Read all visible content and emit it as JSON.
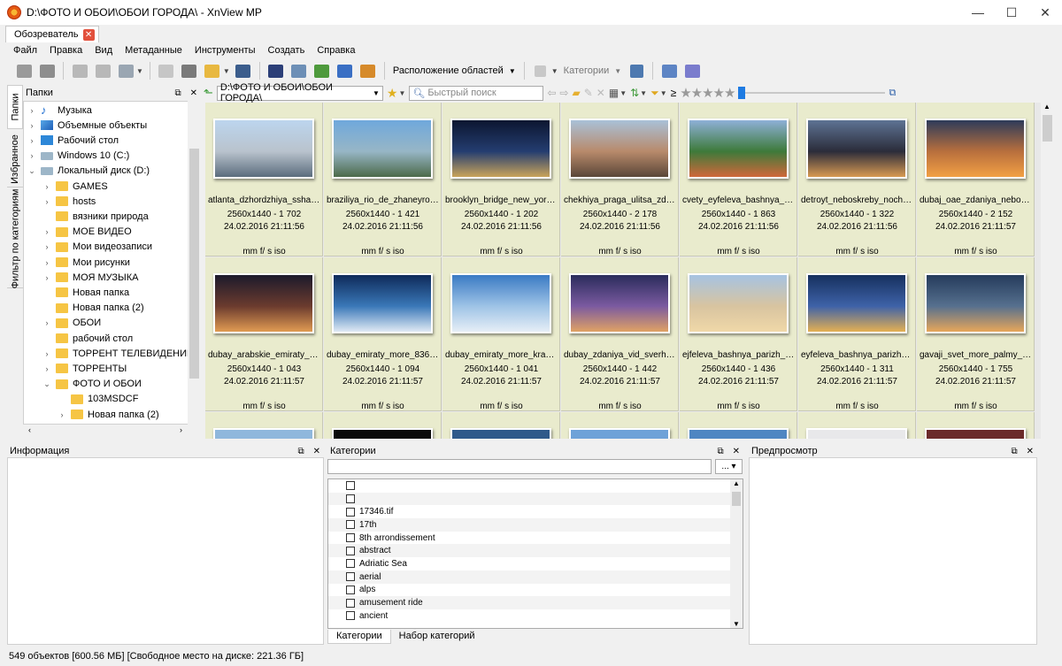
{
  "window": {
    "title": "D:\\ФОТО И ОБОИ\\ОБОИ ГОРОДА\\ - XnView MP",
    "min": "—",
    "max": "☐",
    "close": "✕"
  },
  "tab": {
    "label": "Обозреватель",
    "close": "✕"
  },
  "menu": [
    "Файл",
    "Правка",
    "Вид",
    "Метаданные",
    "Инструменты",
    "Создать",
    "Справка"
  ],
  "toolbar": {
    "layout_label": "Расположение областей",
    "categories_label": "Категории",
    "icons": [
      "back-view-icon",
      "fullscreen-icon",
      "rotate-left-icon",
      "rotate-right-icon",
      "image-menu-icon",
      "compare-icon",
      "print-icon",
      "open-icon",
      "find-icon",
      "folder-view-icon",
      "convert-icon",
      "slideshow-icon",
      "capture-icon",
      "wallpaper-icon",
      "settings-icon",
      "help-icon"
    ]
  },
  "folders_panel": {
    "title": "Папки",
    "vertical_tabs": [
      "Папки",
      "Избранное",
      "Фильтр по категориям"
    ],
    "tree": [
      {
        "label": "Музыка",
        "indent": 1,
        "expander": "›",
        "icon": "music"
      },
      {
        "label": "Объемные объекты",
        "indent": 1,
        "expander": "›",
        "icon": "3d"
      },
      {
        "label": "Рабочий стол",
        "indent": 1,
        "expander": "›",
        "icon": "desktop"
      },
      {
        "label": "Windows 10 (C:)",
        "indent": 1,
        "expander": "›",
        "icon": "drive"
      },
      {
        "label": "Локальный диск (D:)",
        "indent": 1,
        "expander": "⌄",
        "icon": "drive"
      },
      {
        "label": "GAMES",
        "indent": 2,
        "expander": "›",
        "icon": "folder"
      },
      {
        "label": "hosts",
        "indent": 2,
        "expander": "›",
        "icon": "folder"
      },
      {
        "label": "вязники природа",
        "indent": 2,
        "expander": "",
        "icon": "folder"
      },
      {
        "label": "МОЕ ВИДЕО",
        "indent": 2,
        "expander": "›",
        "icon": "folder"
      },
      {
        "label": "Мои видеозаписи",
        "indent": 2,
        "expander": "›",
        "icon": "folder"
      },
      {
        "label": "Мои рисунки",
        "indent": 2,
        "expander": "›",
        "icon": "folder"
      },
      {
        "label": "МОЯ МУЗЫКА",
        "indent": 2,
        "expander": "›",
        "icon": "folder"
      },
      {
        "label": "Новая папка",
        "indent": 2,
        "expander": "",
        "icon": "folder"
      },
      {
        "label": "Новая папка (2)",
        "indent": 2,
        "expander": "",
        "icon": "folder"
      },
      {
        "label": "ОБОИ",
        "indent": 2,
        "expander": "›",
        "icon": "folder"
      },
      {
        "label": "рабочий стол",
        "indent": 2,
        "expander": "",
        "icon": "folder"
      },
      {
        "label": "ТОРРЕНТ ТЕЛЕВИДЕНИЕ",
        "indent": 2,
        "expander": "›",
        "icon": "folder"
      },
      {
        "label": "ТОРРЕНТЫ",
        "indent": 2,
        "expander": "›",
        "icon": "folder"
      },
      {
        "label": "ФОТО И ОБОИ",
        "indent": 2,
        "expander": "⌄",
        "icon": "folder"
      },
      {
        "label": "103MSDCF",
        "indent": 3,
        "expander": "",
        "icon": "folder"
      },
      {
        "label": "Новая папка (2)",
        "indent": 3,
        "expander": "›",
        "icon": "folder"
      }
    ]
  },
  "address": {
    "path": "D:\\ФОТО И ОБОИ\\ОБОИ ГОРОДА\\",
    "search_placeholder": "Быстрый поиск",
    "ge_symbol": "≥",
    "stars": "★★★★★"
  },
  "thumbnails": [
    {
      "name": "atlanta_dzhordzhiya_ssha_n...",
      "info": "2560x1440 - 1 702",
      "date": "24.02.2016 21:11:56",
      "exif": "mm f/ s iso",
      "colors": [
        "#bcd5ee",
        "#b9c3cd",
        "#5b6c7d"
      ]
    },
    {
      "name": "braziliya_rio_de_zhaneyro_s...",
      "info": "2560x1440 - 1 421",
      "date": "24.02.2016 21:11:56",
      "exif": "mm f/ s iso",
      "colors": [
        "#6fa8dc",
        "#97b6c6",
        "#4c6a4a"
      ]
    },
    {
      "name": "brooklyn_bridge_new_york_...",
      "info": "2560x1440 - 1 202",
      "date": "24.02.2016 21:11:56",
      "exif": "mm f/ s iso",
      "colors": [
        "#0c1630",
        "#243d70",
        "#c9a45a"
      ]
    },
    {
      "name": "chekhiya_praga_ulitsa_zdani...",
      "info": "2560x1440 - 2 178",
      "date": "24.02.2016 21:11:56",
      "exif": "mm f/ s iso",
      "colors": [
        "#a9c1d8",
        "#b88a6b",
        "#5a4638"
      ]
    },
    {
      "name": "cvety_eyfeleva_bashnya_de...",
      "info": "2560x1440 - 1 863",
      "date": "24.02.2016 21:11:56",
      "exif": "mm f/ s iso",
      "colors": [
        "#8eb0d8",
        "#3d7a3a",
        "#d0683a"
      ]
    },
    {
      "name": "detroyt_neboskreby_noch_r...",
      "info": "2560x1440 - 1 322",
      "date": "24.02.2016 21:11:56",
      "exif": "mm f/ s iso",
      "colors": [
        "#5e7394",
        "#2b2c3a",
        "#d89a52"
      ]
    },
    {
      "name": "dubaj_oae_zdaniya_neboskr...",
      "info": "2560x1440 - 2 152",
      "date": "24.02.2016 21:11:57",
      "exif": "mm f/ s iso",
      "colors": [
        "#2d3b5a",
        "#b86f3d",
        "#f2a044"
      ]
    },
    {
      "name": "dubay_arabskie_emiraty_no...",
      "info": "2560x1440 - 1 043",
      "date": "24.02.2016 21:11:57",
      "exif": "mm f/ s iso",
      "colors": [
        "#1c1a2c",
        "#6b3b2e",
        "#e09b52"
      ]
    },
    {
      "name": "dubay_emiraty_more_83651...",
      "info": "2560x1440 - 1 094",
      "date": "24.02.2016 21:11:57",
      "exif": "mm f/ s iso",
      "colors": [
        "#0e2a5a",
        "#3a78b8",
        "#dfe9f4"
      ]
    },
    {
      "name": "dubay_emiraty_more_krasiv...",
      "info": "2560x1440 - 1 041",
      "date": "24.02.2016 21:11:57",
      "exif": "mm f/ s iso",
      "colors": [
        "#3a7ac4",
        "#9ec3e6",
        "#e6eef6"
      ]
    },
    {
      "name": "dubay_zdaniya_vid_sverhu_...",
      "info": "2560x1440 - 1 442",
      "date": "24.02.2016 21:11:57",
      "exif": "mm f/ s iso",
      "colors": [
        "#2a2c5c",
        "#7b5aa0",
        "#e0a264"
      ]
    },
    {
      "name": "ejfeleva_bashnya_parizh_zol...",
      "info": "2560x1440 - 1 436",
      "date": "24.02.2016 21:11:57",
      "exif": "mm f/ s iso",
      "colors": [
        "#a6c3e2",
        "#d8c4a0",
        "#f0d8a8"
      ]
    },
    {
      "name": "eyfeleva_bashnya_parizh_n...",
      "info": "2560x1440 - 1 311",
      "date": "24.02.2016 21:11:57",
      "exif": "mm f/ s iso",
      "colors": [
        "#16305e",
        "#3e62a8",
        "#e4b052"
      ]
    },
    {
      "name": "gavaji_svet_more_palmy_n...",
      "info": "2560x1440 - 1 755",
      "date": "24.02.2016 21:11:57",
      "exif": "mm f/ s iso",
      "colors": [
        "#253b5c",
        "#56708e",
        "#e6a65a"
      ]
    }
  ],
  "third_row_colors": [
    "#8fb7dc",
    "#0a0a0a",
    "#2f5a8a",
    "#6ea2d8",
    "#4f86c2",
    "#e8e8ea",
    "#6b2a2a"
  ],
  "info_panel": {
    "title": "Информация"
  },
  "categories_panel": {
    "title": "Категории",
    "button": "...",
    "items": [
      "",
      "",
      "17346.tif",
      "17th",
      "8th arrondissement",
      "abstract",
      "Adriatic Sea",
      "aerial",
      "alps",
      "amusement ride",
      "ancient"
    ],
    "tabs": [
      "Категории",
      "Набор категорий"
    ]
  },
  "preview_panel": {
    "title": "Предпросмотр"
  },
  "status": "549 объектов [600.56 МБ] [Свободное место на диске: 221.36 ГБ]"
}
